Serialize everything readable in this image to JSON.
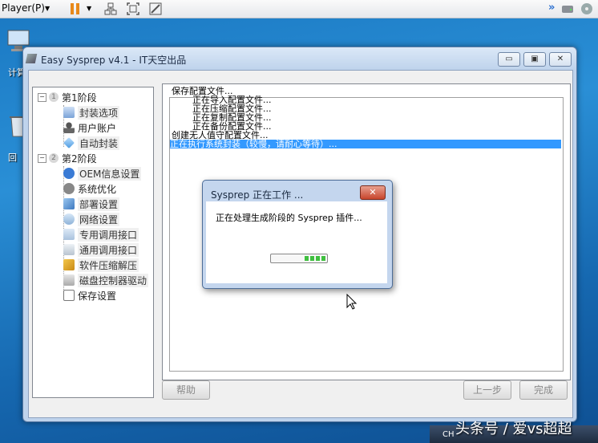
{
  "player": {
    "menu_label": "Player(P)"
  },
  "desktop": {
    "icons": [
      "计算",
      "回",
      "回"
    ]
  },
  "window": {
    "title": "Easy Sysprep v4.1 - IT天空出品",
    "caption_buttons": [
      "minimize",
      "maximize",
      "close"
    ]
  },
  "tree": {
    "stage1": {
      "num": "1",
      "label": "第1阶段"
    },
    "stage1_items": [
      "封装选项",
      "用户账户",
      "自动封装"
    ],
    "stage2": {
      "num": "2",
      "label": "第2阶段"
    },
    "stage2_items": [
      "OEM信息设置",
      "系统优化",
      "部署设置",
      "网络设置",
      "专用调用接口",
      "通用调用接口",
      "软件压缩解压",
      "磁盘控制器驱动",
      "保存设置"
    ]
  },
  "log": {
    "lines": [
      "保存配置文件...",
      "正在导入配置文件...",
      "正在压缩配置文件...",
      "正在复制配置文件...",
      "正在备份配置文件...",
      "创建无人值守配置文件...",
      "正在执行系统封装（较慢，请耐心等待）..."
    ]
  },
  "buttons": {
    "help": "帮助",
    "prev": "上一步",
    "finish": "完成"
  },
  "dialog": {
    "title": "Sysprep 正在工作 ...",
    "message": "正在处理生成阶段的 Sysprep 插件...",
    "close_label": "✕",
    "progress_note": "indeterminate marquee"
  },
  "taskbar": {
    "input_lang": "CH"
  },
  "watermark": "头条号 / 爱vs超超",
  "colors": {
    "selection": "#3399ff",
    "progress": "#3fbf3f",
    "desktop": "#1f80c8"
  }
}
